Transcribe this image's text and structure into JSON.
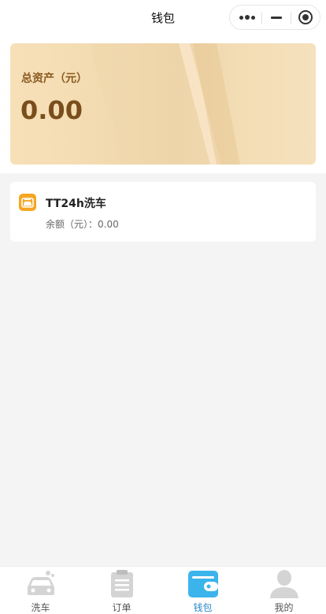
{
  "header": {
    "title": "钱包"
  },
  "assets": {
    "label": "总资产（元）",
    "value": "0.00"
  },
  "wallets": [
    {
      "name": "TT24h洗车",
      "balance_label": "余额（元）：",
      "balance_value": "0.00",
      "icon": "car-wash-icon"
    }
  ],
  "tabbar": {
    "items": [
      {
        "label": "洗车",
        "icon": "car-icon",
        "active": false
      },
      {
        "label": "订单",
        "icon": "clipboard-icon",
        "active": false
      },
      {
        "label": "钱包",
        "icon": "wallet-icon",
        "active": true
      },
      {
        "label": "我的",
        "icon": "user-icon",
        "active": false
      }
    ]
  },
  "colors": {
    "accent": "#3bb4ec",
    "card_text": "#7a4e1c",
    "icon_orange": "#f5a623",
    "tab_inactive": "#d4d4d4"
  }
}
